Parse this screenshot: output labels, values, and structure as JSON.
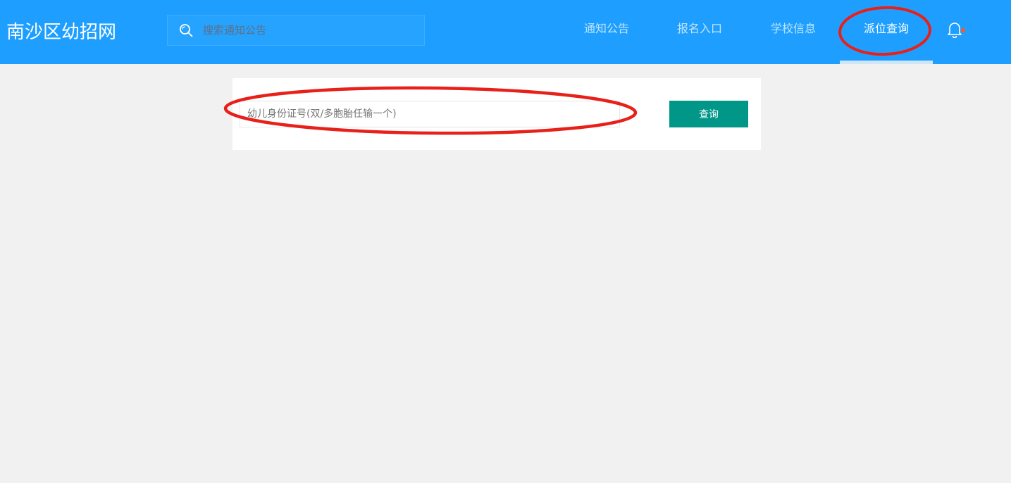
{
  "header": {
    "logo": "南沙区幼招网",
    "search_placeholder": "搜索通知公告",
    "nav": [
      {
        "label": "通知公告"
      },
      {
        "label": "报名入口"
      },
      {
        "label": "学校信息"
      },
      {
        "label": "派位查询",
        "active": true
      }
    ],
    "bell_icon": "bell-icon",
    "notification_dot_color": "#ff5722"
  },
  "query_panel": {
    "id_placeholder": "幼儿身份证号(双/多胞胎任输一个)",
    "button_label": "查询"
  },
  "colors": {
    "header_bg": "#1e9fff",
    "page_bg": "#f1f1f1",
    "button_bg": "#009688",
    "annotation": "#e8201a"
  }
}
